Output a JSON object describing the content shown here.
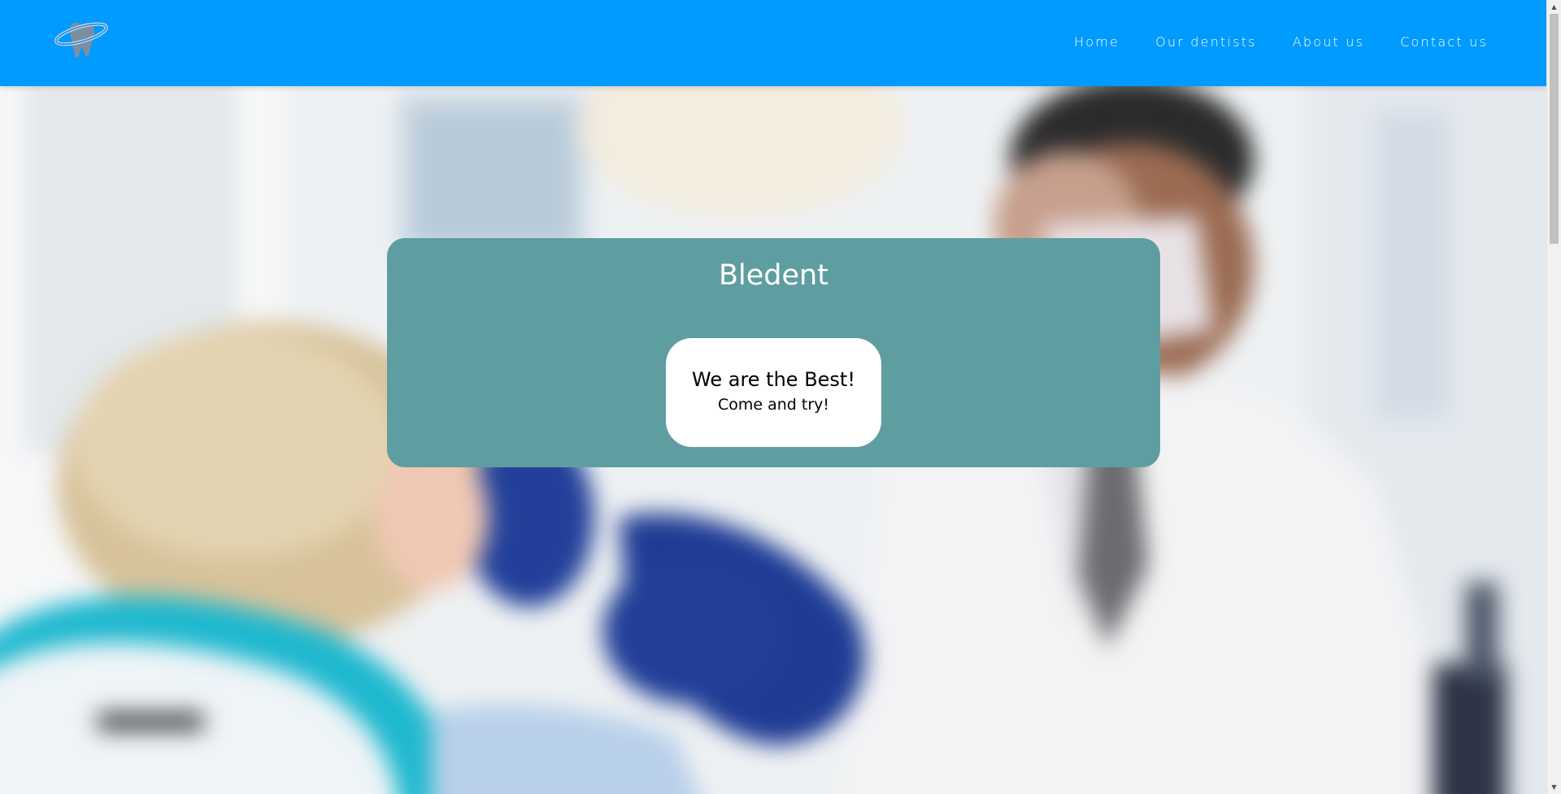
{
  "header": {
    "logo_icon": "tooth-logo-icon",
    "nav": {
      "home": "Home",
      "dentists": "Our dentists",
      "about": "About us",
      "contact": "Contact us"
    },
    "color": "#009bff"
  },
  "hero": {
    "background_image": "blurred-dentist-photo",
    "card": {
      "title": "Bledent",
      "badge_headline": "We are the Best!",
      "badge_subline": "Come and try!",
      "color": "#5f9ea0"
    }
  },
  "scrollbar": {
    "up_icon": "scroll-up-arrow-icon",
    "down_icon": "scroll-down-arrow-icon"
  }
}
